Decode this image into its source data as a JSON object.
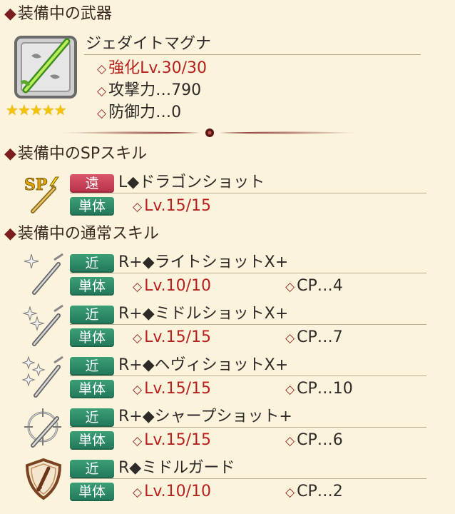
{
  "weapon_section": {
    "title": "装備中の武器",
    "name": "ジェダイトマグナ",
    "rarity_stars": "★★★★★",
    "enhance": "強化Lv.30/30",
    "attack": "攻撃力…790",
    "defense": "防御力…0"
  },
  "sp_section": {
    "title": "装備中のSPスキル",
    "skill": {
      "icon": "sp-lightning-gun-icon",
      "range_tag": "遠",
      "target_tag": "単体",
      "name": "L◆ドラゴンショット",
      "level": "Lv.15/15"
    }
  },
  "normal_section": {
    "title": "装備中の通常スキル",
    "skills": [
      {
        "icon": "sparkle-gun-icon",
        "range_tag": "近",
        "target_tag": "単体",
        "name": "R+◆ライトショットX+",
        "level": "Lv.10/10",
        "cp": "CP…4"
      },
      {
        "icon": "double-sparkle-gun-icon",
        "range_tag": "近",
        "target_tag": "単体",
        "name": "R+◆ミドルショットX+",
        "level": "Lv.15/15",
        "cp": "CP…7"
      },
      {
        "icon": "triple-sparkle-gun-icon",
        "range_tag": "近",
        "target_tag": "単体",
        "name": "R+◆ヘヴィショットX+",
        "level": "Lv.15/15",
        "cp": "CP…10"
      },
      {
        "icon": "crosshair-gun-icon",
        "range_tag": "近",
        "target_tag": "単体",
        "name": "R+◆シャープショット+",
        "level": "Lv.15/15",
        "cp": "CP…6"
      },
      {
        "icon": "shield-gun-icon",
        "range_tag": "近",
        "target_tag": "単体",
        "name": "R◆ミドルガード",
        "level": "Lv.10/10",
        "cp": "CP…2"
      }
    ]
  },
  "colors": {
    "background": "#fbf3dc",
    "tag_red": "#c83a52",
    "tag_green": "#2a8a66",
    "accent_red": "#b8201e",
    "star": "#f5c400"
  }
}
